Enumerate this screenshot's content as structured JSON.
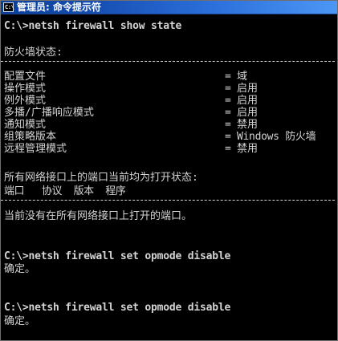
{
  "window": {
    "title": "管理员: 命令提示符",
    "icon": "cmd-prompt-icon",
    "icon_glyph": "C:\\"
  },
  "console": {
    "commands": [
      "C:\\>netsh firewall show state",
      "C:\\>netsh firewall set opmode disable",
      "C:\\>netsh firewall set opmode disable"
    ],
    "firewall_status_header": "防火墙状态:",
    "divider": "-------------------------------------------------------------------",
    "settings": [
      {
        "label": "配置文件",
        "value": "域"
      },
      {
        "label": "操作模式",
        "value": "启用"
      },
      {
        "label": "例外模式",
        "value": "启用"
      },
      {
        "label": "多播/广播响应模式",
        "value": "启用"
      },
      {
        "label": "通知模式",
        "value": "禁用"
      },
      {
        "label": "组策略版本",
        "value": "Windows 防火墙"
      },
      {
        "label": "远程管理模式",
        "value": "禁用"
      }
    ],
    "ports_header": "所有网络接口上的端口当前均为打开状态:",
    "port_columns": "端口   协议  版本  程序",
    "no_open_ports": "当前没有在所有网络接口上打开的端口。",
    "ok_messages": [
      "确定。",
      "确定。"
    ]
  },
  "theme": {
    "title_gradient": [
      "#083f9b",
      "#4d97f5"
    ],
    "console_bg": "#000000",
    "console_fg": "#d4d4d4"
  }
}
